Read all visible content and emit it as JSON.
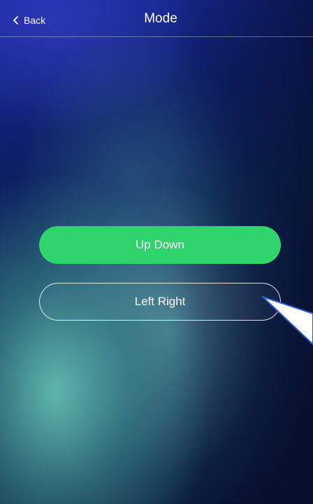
{
  "header": {
    "back_label": "Back",
    "title": "Mode"
  },
  "modes": {
    "up_down_label": "Up Down",
    "left_right_label": "Left Right",
    "selected": "Up Down"
  },
  "colors": {
    "selected_button": "#2fd46c",
    "annotation_arrow": "#2a5bd7"
  }
}
